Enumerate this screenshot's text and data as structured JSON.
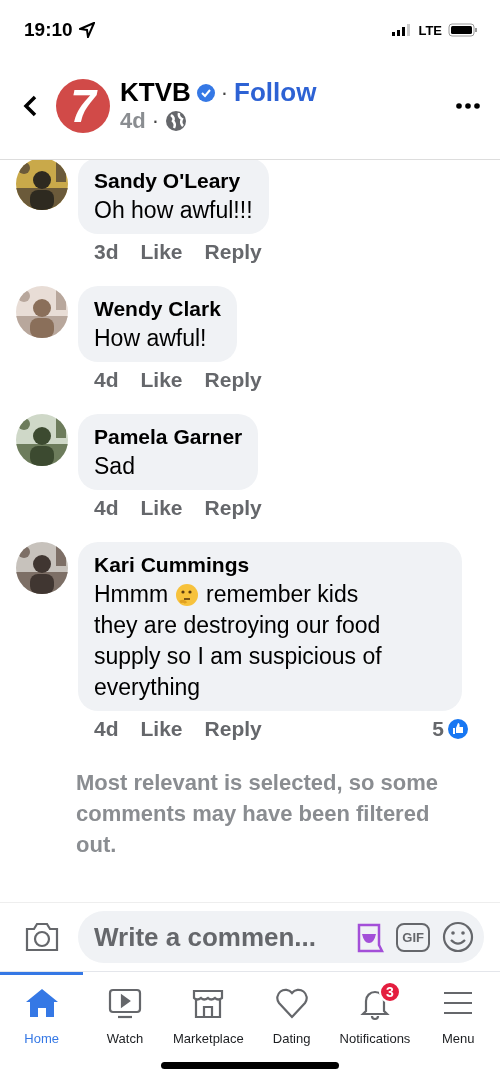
{
  "status_bar": {
    "time": "19:10",
    "network": "LTE"
  },
  "header": {
    "page_name": "KTVB",
    "logo_text": "7",
    "verified": true,
    "follow": "Follow",
    "time": "4d",
    "separator": "·"
  },
  "comments": [
    {
      "author": "Sandy O'Leary",
      "text": "Oh how awful!!!",
      "time": "3d",
      "like": "Like",
      "reply": "Reply"
    },
    {
      "author": "Wendy Clark",
      "text": "How awful!",
      "time": "4d",
      "like": "Like",
      "reply": "Reply"
    },
    {
      "author": "Pamela Garner",
      "text": "Sad",
      "time": "4d",
      "like": "Like",
      "reply": "Reply"
    },
    {
      "author": "Kari Cummings",
      "text": "Hmmm",
      "after_emoji": "remember kids",
      "continuation": "they are destroying our food supply so I am suspicious of everything",
      "time": "4d",
      "like": "Like",
      "reply": "Reply",
      "reactions": "5"
    }
  ],
  "filter_note": "Most relevant is selected, so some comments may have been filtered out.",
  "composer": {
    "placeholder": "Write a commen...",
    "gif": "GIF"
  },
  "tabs": [
    {
      "kind": "home",
      "label": "Home",
      "selected": true
    },
    {
      "kind": "watch",
      "label": "Watch",
      "selected": false
    },
    {
      "kind": "marketplace",
      "label": "Marketplace",
      "selected": false
    },
    {
      "kind": "dating",
      "label": "Dating",
      "selected": false
    },
    {
      "kind": "notifications",
      "label": "Notifications",
      "selected": false,
      "badge": "3"
    },
    {
      "kind": "menu",
      "label": "Menu",
      "selected": false
    }
  ]
}
